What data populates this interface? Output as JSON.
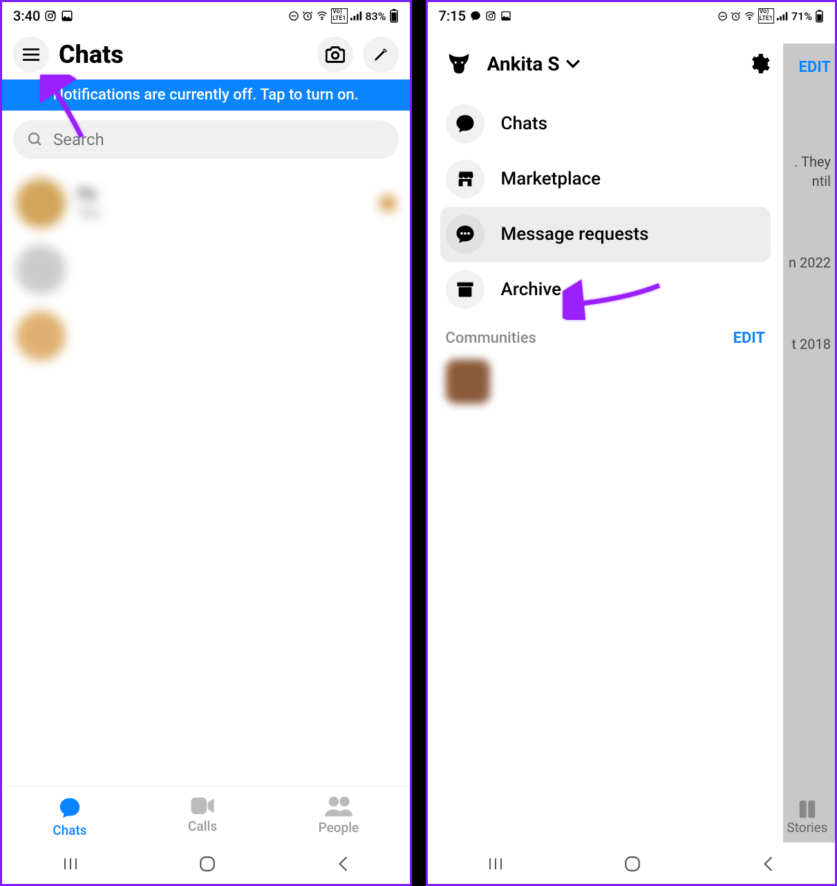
{
  "left": {
    "status": {
      "time": "3:40",
      "battery": "83%"
    },
    "title": "Chats",
    "notification_banner": "Notifications are currently off. Tap to turn on.",
    "search_placeholder": "Search",
    "chats": [
      {
        "name": "Pa",
        "preview": "You"
      },
      {
        "name": " ",
        "preview": " "
      },
      {
        "name": " ",
        "preview": " "
      }
    ],
    "tabs": {
      "chats": "Chats",
      "calls": "Calls",
      "people": "People"
    }
  },
  "right": {
    "status": {
      "time": "7:15",
      "battery": "71%"
    },
    "underlay": {
      "edit": "EDIT",
      "peek1": ". They\nntil",
      "peek2": "n 2022",
      "peek3": "t 2018",
      "stories": "Stories"
    },
    "profile_name": "Ankita S",
    "menu": {
      "chats": "Chats",
      "marketplace": "Marketplace",
      "message_requests": "Message requests",
      "archive": "Archive"
    },
    "communities_label": "Communities",
    "communities_edit": "EDIT",
    "community": {
      "name": " ",
      "sub": " "
    }
  },
  "colors": {
    "accent": "#0a84ff",
    "arrow": "#9b1fff"
  }
}
